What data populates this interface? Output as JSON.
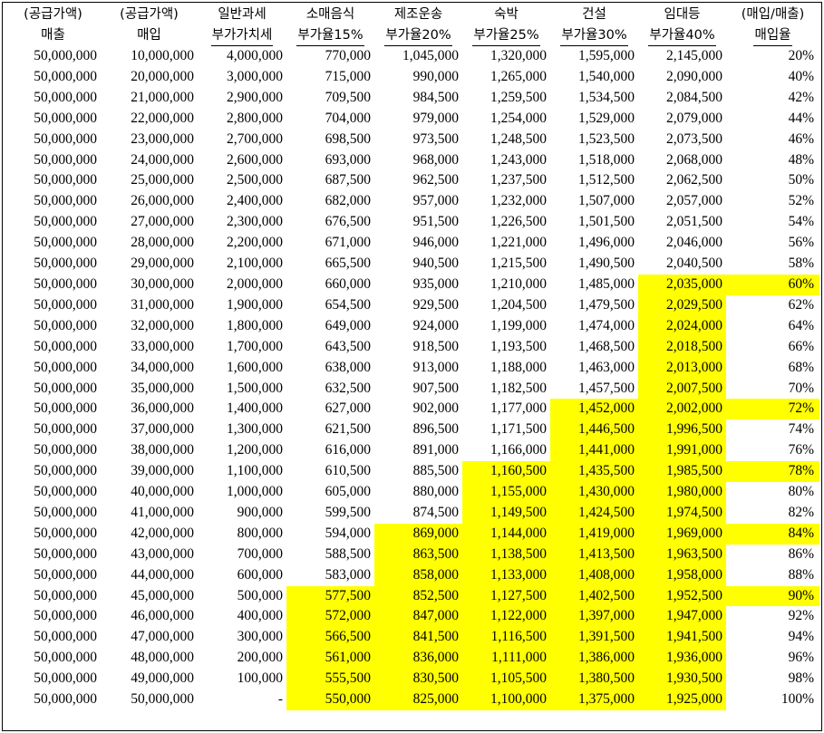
{
  "headers_top": [
    "(공급가액)",
    "(공급가액)",
    "일반과세",
    "소매음식",
    "제조운송",
    "숙박",
    "건설",
    "임대등",
    "(매입/매출)"
  ],
  "headers_bottom": [
    "매출",
    "매입",
    "부가가치세",
    "부가율15%",
    "부가율20%",
    "부가율25%",
    "부가율30%",
    "부가율40%",
    "매입율"
  ],
  "highlight_color": "#ffff00",
  "rows": [
    {
      "cells": [
        "50,000,000",
        "10,000,000",
        "4,000,000",
        "770,000",
        "1,045,000",
        "1,320,000",
        "1,595,000",
        "2,145,000",
        "20%"
      ],
      "hl": []
    },
    {
      "cells": [
        "50,000,000",
        "20,000,000",
        "3,000,000",
        "715,000",
        "990,000",
        "1,265,000",
        "1,540,000",
        "2,090,000",
        "40%"
      ],
      "hl": []
    },
    {
      "cells": [
        "50,000,000",
        "21,000,000",
        "2,900,000",
        "709,500",
        "984,500",
        "1,259,500",
        "1,534,500",
        "2,084,500",
        "42%"
      ],
      "hl": []
    },
    {
      "cells": [
        "50,000,000",
        "22,000,000",
        "2,800,000",
        "704,000",
        "979,000",
        "1,254,000",
        "1,529,000",
        "2,079,000",
        "44%"
      ],
      "hl": []
    },
    {
      "cells": [
        "50,000,000",
        "23,000,000",
        "2,700,000",
        "698,500",
        "973,500",
        "1,248,500",
        "1,523,500",
        "2,073,500",
        "46%"
      ],
      "hl": []
    },
    {
      "cells": [
        "50,000,000",
        "24,000,000",
        "2,600,000",
        "693,000",
        "968,000",
        "1,243,000",
        "1,518,000",
        "2,068,000",
        "48%"
      ],
      "hl": []
    },
    {
      "cells": [
        "50,000,000",
        "25,000,000",
        "2,500,000",
        "687,500",
        "962,500",
        "1,237,500",
        "1,512,500",
        "2,062,500",
        "50%"
      ],
      "hl": []
    },
    {
      "cells": [
        "50,000,000",
        "26,000,000",
        "2,400,000",
        "682,000",
        "957,000",
        "1,232,000",
        "1,507,000",
        "2,057,000",
        "52%"
      ],
      "hl": []
    },
    {
      "cells": [
        "50,000,000",
        "27,000,000",
        "2,300,000",
        "676,500",
        "951,500",
        "1,226,500",
        "1,501,500",
        "2,051,500",
        "54%"
      ],
      "hl": []
    },
    {
      "cells": [
        "50,000,000",
        "28,000,000",
        "2,200,000",
        "671,000",
        "946,000",
        "1,221,000",
        "1,496,000",
        "2,046,000",
        "56%"
      ],
      "hl": []
    },
    {
      "cells": [
        "50,000,000",
        "29,000,000",
        "2,100,000",
        "665,500",
        "940,500",
        "1,215,500",
        "1,490,500",
        "2,040,500",
        "58%"
      ],
      "hl": []
    },
    {
      "cells": [
        "50,000,000",
        "30,000,000",
        "2,000,000",
        "660,000",
        "935,000",
        "1,210,000",
        "1,485,000",
        "2,035,000",
        "60%"
      ],
      "hl": [
        7,
        8
      ]
    },
    {
      "cells": [
        "50,000,000",
        "31,000,000",
        "1,900,000",
        "654,500",
        "929,500",
        "1,204,500",
        "1,479,500",
        "2,029,500",
        "62%"
      ],
      "hl": [
        7
      ]
    },
    {
      "cells": [
        "50,000,000",
        "32,000,000",
        "1,800,000",
        "649,000",
        "924,000",
        "1,199,000",
        "1,474,000",
        "2,024,000",
        "64%"
      ],
      "hl": [
        7
      ]
    },
    {
      "cells": [
        "50,000,000",
        "33,000,000",
        "1,700,000",
        "643,500",
        "918,500",
        "1,193,500",
        "1,468,500",
        "2,018,500",
        "66%"
      ],
      "hl": [
        7
      ]
    },
    {
      "cells": [
        "50,000,000",
        "34,000,000",
        "1,600,000",
        "638,000",
        "913,000",
        "1,188,000",
        "1,463,000",
        "2,013,000",
        "68%"
      ],
      "hl": [
        7
      ]
    },
    {
      "cells": [
        "50,000,000",
        "35,000,000",
        "1,500,000",
        "632,500",
        "907,500",
        "1,182,500",
        "1,457,500",
        "2,007,500",
        "70%"
      ],
      "hl": [
        7
      ]
    },
    {
      "cells": [
        "50,000,000",
        "36,000,000",
        "1,400,000",
        "627,000",
        "902,000",
        "1,177,000",
        "1,452,000",
        "2,002,000",
        "72%"
      ],
      "hl": [
        6,
        7,
        8
      ]
    },
    {
      "cells": [
        "50,000,000",
        "37,000,000",
        "1,300,000",
        "621,500",
        "896,500",
        "1,171,500",
        "1,446,500",
        "1,996,500",
        "74%"
      ],
      "hl": [
        6,
        7
      ]
    },
    {
      "cells": [
        "50,000,000",
        "38,000,000",
        "1,200,000",
        "616,000",
        "891,000",
        "1,166,000",
        "1,441,000",
        "1,991,000",
        "76%"
      ],
      "hl": [
        6,
        7
      ]
    },
    {
      "cells": [
        "50,000,000",
        "39,000,000",
        "1,100,000",
        "610,500",
        "885,500",
        "1,160,500",
        "1,435,500",
        "1,985,500",
        "78%"
      ],
      "hl": [
        5,
        6,
        7,
        8
      ]
    },
    {
      "cells": [
        "50,000,000",
        "40,000,000",
        "1,000,000",
        "605,000",
        "880,000",
        "1,155,000",
        "1,430,000",
        "1,980,000",
        "80%"
      ],
      "hl": [
        5,
        6,
        7
      ]
    },
    {
      "cells": [
        "50,000,000",
        "41,000,000",
        "900,000",
        "599,500",
        "874,500",
        "1,149,500",
        "1,424,500",
        "1,974,500",
        "82%"
      ],
      "hl": [
        5,
        6,
        7
      ]
    },
    {
      "cells": [
        "50,000,000",
        "42,000,000",
        "800,000",
        "594,000",
        "869,000",
        "1,144,000",
        "1,419,000",
        "1,969,000",
        "84%"
      ],
      "hl": [
        4,
        5,
        6,
        7,
        8
      ]
    },
    {
      "cells": [
        "50,000,000",
        "43,000,000",
        "700,000",
        "588,500",
        "863,500",
        "1,138,500",
        "1,413,500",
        "1,963,500",
        "86%"
      ],
      "hl": [
        4,
        5,
        6,
        7
      ]
    },
    {
      "cells": [
        "50,000,000",
        "44,000,000",
        "600,000",
        "583,000",
        "858,000",
        "1,133,000",
        "1,408,000",
        "1,958,000",
        "88%"
      ],
      "hl": [
        4,
        5,
        6,
        7
      ]
    },
    {
      "cells": [
        "50,000,000",
        "45,000,000",
        "500,000",
        "577,500",
        "852,500",
        "1,127,500",
        "1,402,500",
        "1,952,500",
        "90%"
      ],
      "hl": [
        3,
        4,
        5,
        6,
        7,
        8
      ]
    },
    {
      "cells": [
        "50,000,000",
        "46,000,000",
        "400,000",
        "572,000",
        "847,000",
        "1,122,000",
        "1,397,000",
        "1,947,000",
        "92%"
      ],
      "hl": [
        3,
        4,
        5,
        6,
        7
      ]
    },
    {
      "cells": [
        "50,000,000",
        "47,000,000",
        "300,000",
        "566,500",
        "841,500",
        "1,116,500",
        "1,391,500",
        "1,941,500",
        "94%"
      ],
      "hl": [
        3,
        4,
        5,
        6,
        7
      ]
    },
    {
      "cells": [
        "50,000,000",
        "48,000,000",
        "200,000",
        "561,000",
        "836,000",
        "1,111,000",
        "1,386,000",
        "1,936,000",
        "96%"
      ],
      "hl": [
        3,
        4,
        5,
        6,
        7
      ]
    },
    {
      "cells": [
        "50,000,000",
        "49,000,000",
        "100,000",
        "555,500",
        "830,500",
        "1,105,500",
        "1,380,500",
        "1,930,500",
        "98%"
      ],
      "hl": [
        3,
        4,
        5,
        6,
        7
      ]
    },
    {
      "cells": [
        "50,000,000",
        "50,000,000",
        "-",
        "550,000",
        "825,000",
        "1,100,000",
        "1,375,000",
        "1,925,000",
        "100%"
      ],
      "hl": [
        3,
        4,
        5,
        6,
        7
      ]
    }
  ]
}
